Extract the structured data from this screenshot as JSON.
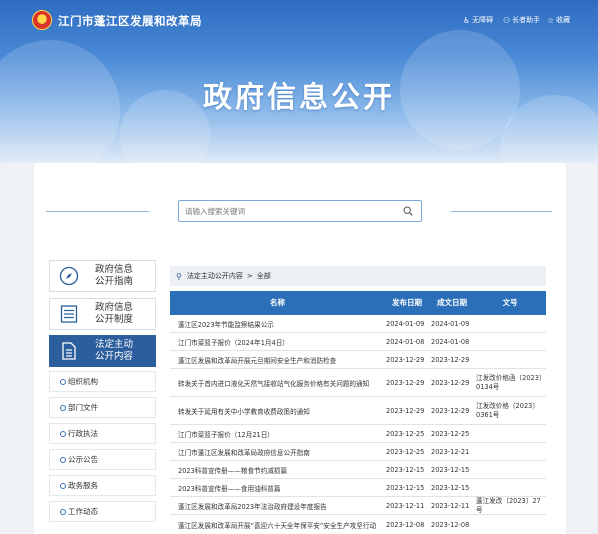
{
  "header": {
    "site_title": "江门市蓬江区发展和改革局",
    "utilities": [
      {
        "icon": "accessibility-icon",
        "label": "无障碍"
      },
      {
        "icon": "elder-assist-icon",
        "label": "长者助手"
      },
      {
        "icon": "bookmark-icon",
        "label": "收藏"
      }
    ],
    "hero_title": "政府信息公开"
  },
  "search": {
    "placeholder": "请输入搜索关键词",
    "value": ""
  },
  "sidebar": {
    "cards": [
      {
        "label_line1": "政府信息",
        "label_line2": "公开指南",
        "icon": "compass-icon",
        "active": false
      },
      {
        "label_line1": "政府信息",
        "label_line2": "公开制度",
        "icon": "list-document-icon",
        "active": false
      },
      {
        "label_line1": "法定主动",
        "label_line2": "公开内容",
        "icon": "document-icon",
        "active": true
      }
    ],
    "sub_items": [
      "组织机构",
      "部门文件",
      "行政执法",
      "公示公告",
      "政务服务",
      "工作动态"
    ]
  },
  "breadcrumb": {
    "items": [
      "法定主动公开内容",
      "全部"
    ],
    "separator": ">"
  },
  "table": {
    "columns": [
      "名称",
      "发布日期",
      "成文日期",
      "文号"
    ],
    "rows": [
      {
        "name": "蓬江区2023年节能监察结果公示",
        "pub": "2024-01-09",
        "gen": "2024-01-09",
        "doc": ""
      },
      {
        "name": "江门市菜篮子报价（2024年1月4日）",
        "pub": "2024-01-08",
        "gen": "2024-01-08",
        "doc": ""
      },
      {
        "name": "蓬江区发展和改革局开展元旦期间安全生产和消防检查",
        "pub": "2023-12-29",
        "gen": "2023-12-29",
        "doc": ""
      },
      {
        "name": "转发关于首内进口液化天然气接收站气化服务价格有关问题的通知",
        "pub": "2023-12-29",
        "gen": "2023-12-29",
        "doc": "江发改价格函〔2023〕0134号"
      },
      {
        "name": "转发关于延用有关中小学教育收费政策的通知",
        "pub": "2023-12-29",
        "gen": "2023-12-29",
        "doc": "江发改价格〔2023〕0361号"
      },
      {
        "name": "江门市菜篮子报价（12月21日）",
        "pub": "2023-12-25",
        "gen": "2023-12-25",
        "doc": ""
      },
      {
        "name": "江门市蓬江区发展和改革局政府信息公开指南",
        "pub": "2023-12-25",
        "gen": "2023-12-21",
        "doc": ""
      },
      {
        "name": "2023科普宣传册——粮食节约减损篇",
        "pub": "2023-12-15",
        "gen": "2023-12-15",
        "doc": ""
      },
      {
        "name": "2023科普宣传册——食用油科普篇",
        "pub": "2023-12-15",
        "gen": "2023-12-15",
        "doc": ""
      },
      {
        "name": "蓬江区发展和改革局2023年法治政府建设年度报告",
        "pub": "2023-12-11",
        "gen": "2023-12-11",
        "doc": "蓬江发改〔2023〕27号"
      },
      {
        "name": "蓬江区发展和改革局开展“喜迎六十天全年保平安”安全生产攻坚行动",
        "pub": "2023-12-08",
        "gen": "2023-12-08",
        "doc": ""
      }
    ]
  },
  "colors": {
    "primary": "#2c5d9c",
    "table_header": "#2c6fb9",
    "banner_top": "#2d6cc0"
  }
}
